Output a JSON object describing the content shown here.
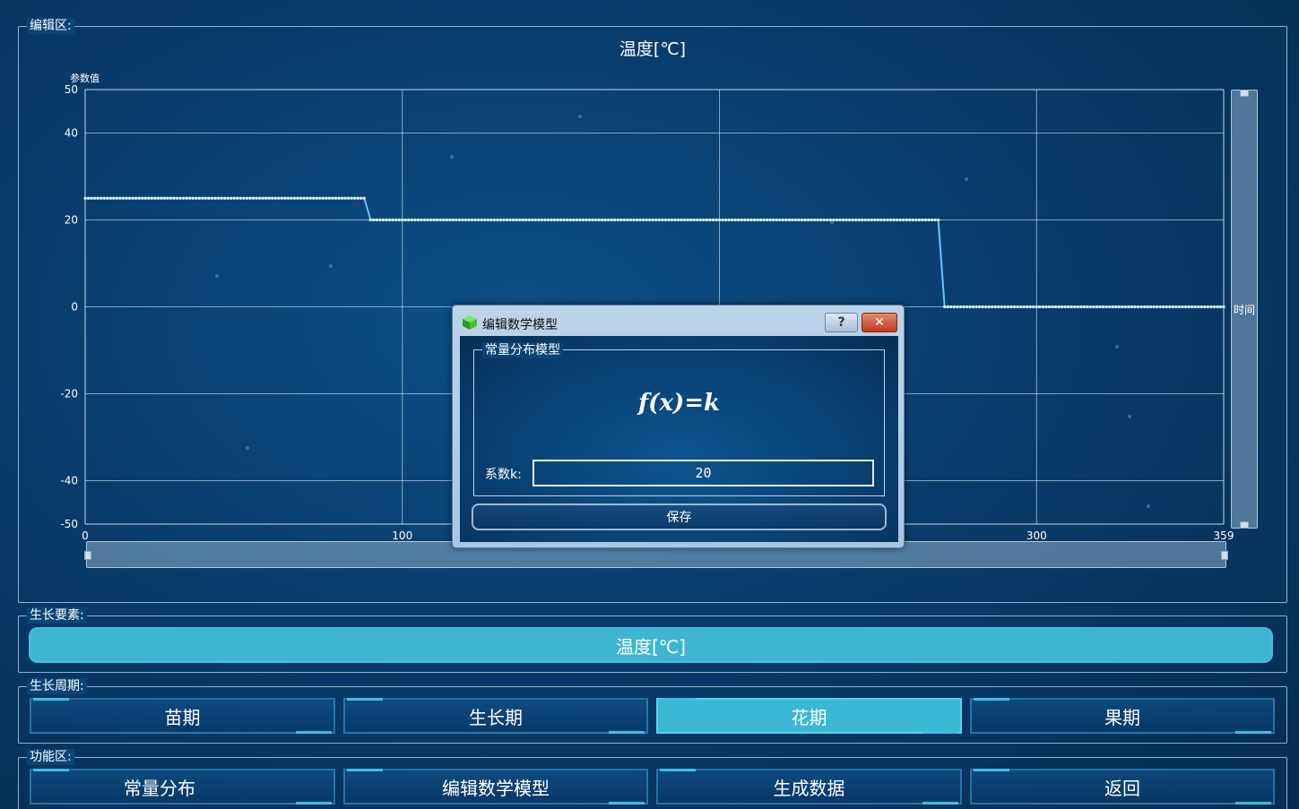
{
  "editor": {
    "group_title": "编辑区:",
    "chart_title": "温度[℃]",
    "y_axis_title": "参数值",
    "x_axis_title": "时间"
  },
  "chart_data": {
    "type": "line",
    "title": "温度[℃]",
    "xlabel": "时间",
    "ylabel": "参数值",
    "xlim": [
      0,
      359
    ],
    "ylim": [
      -50,
      50
    ],
    "x_ticks": [
      "0",
      "100",
      "300",
      "359"
    ],
    "y_ticks": [
      "50",
      "40",
      "20",
      "0",
      "-20",
      "-40",
      "-50"
    ],
    "grid": true,
    "series": [
      {
        "segments": [
          {
            "x_start": 0,
            "x_end": 88,
            "y": 25
          },
          {
            "x_start": 90,
            "x_end": 269,
            "y": 20
          },
          {
            "x_start": 271,
            "x_end": 359,
            "y": 0
          }
        ]
      }
    ]
  },
  "growth_element": {
    "group_title": "生长要素:",
    "selected": "温度[℃]"
  },
  "growth_period": {
    "group_title": "生长周期:",
    "items": [
      {
        "label": "苗期",
        "active": false
      },
      {
        "label": "生长期",
        "active": false
      },
      {
        "label": "花期",
        "active": true
      },
      {
        "label": "果期",
        "active": false
      }
    ]
  },
  "functions": {
    "group_title": "功能区:",
    "items": [
      {
        "label": "常量分布"
      },
      {
        "label": "编辑数学模型"
      },
      {
        "label": "生成数据"
      },
      {
        "label": "返回"
      }
    ]
  },
  "dialog": {
    "title": "编辑数学模型",
    "help_label": "?",
    "close_label": "✕",
    "model_group_title": "常量分布模型",
    "formula": "f(x)=k",
    "k_label": "系数k:",
    "k_value": "20",
    "save_label": "保存"
  },
  "colors": {
    "accent": "#3bb8d4",
    "line": "#5fc6ff",
    "background": "#083c6c"
  }
}
